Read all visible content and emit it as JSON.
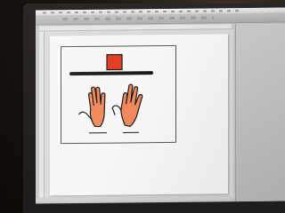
{
  "photo": {
    "subject": "monitor-showing-graphic-editor"
  },
  "colors": {
    "block": "#e23b1f",
    "hand_skin": "#f08a5c",
    "outline": "#1a1a1a",
    "page": "#f7f7f6",
    "app_chrome": "#c9c8c6"
  },
  "artwork": {
    "elements": [
      "red-square",
      "horizontal-bar",
      "left-hand",
      "right-hand"
    ]
  }
}
